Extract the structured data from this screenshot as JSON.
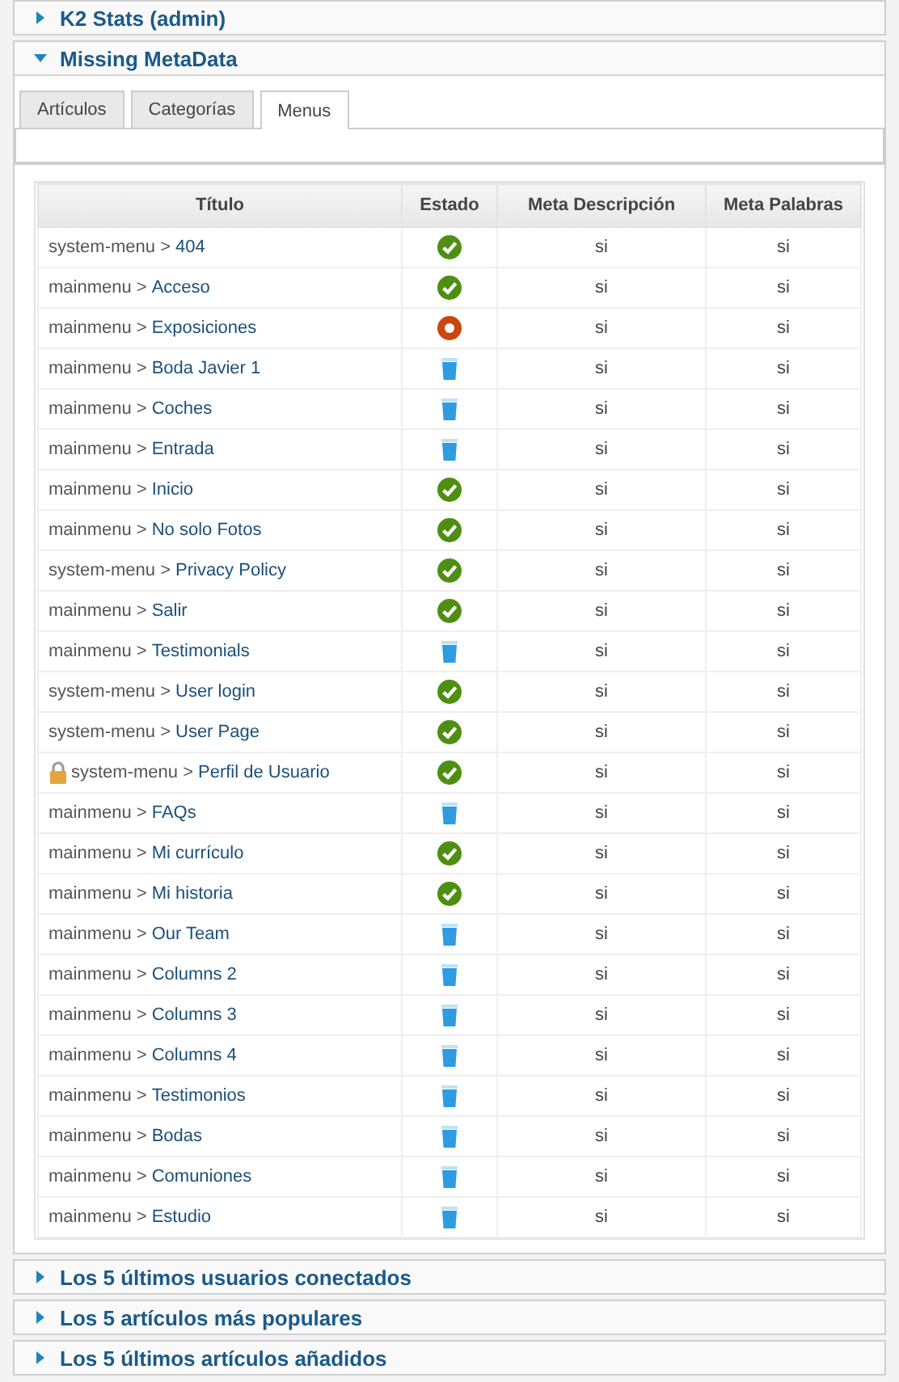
{
  "panels_top": [
    {
      "title": "K2 Stats (admin)",
      "expanded": false
    },
    {
      "title": "Missing MetaData",
      "expanded": true
    }
  ],
  "tabs": [
    {
      "label": "Artículos",
      "selected": false
    },
    {
      "label": "Categorías",
      "selected": false
    },
    {
      "label": "Menus",
      "selected": true
    }
  ],
  "table": {
    "columns": [
      "Título",
      "Estado",
      "Meta Descripción",
      "Meta Palabras"
    ],
    "rows": [
      {
        "menu": "system-menu >",
        "item": "404",
        "locked": false,
        "kind": "published",
        "meta_description": "si",
        "meta_keywords": "si"
      },
      {
        "menu": "mainmenu >",
        "item": "Acceso",
        "locked": false,
        "kind": "published",
        "meta_description": "si",
        "meta_keywords": "si"
      },
      {
        "menu": "mainmenu >",
        "item": "Exposiciones",
        "locked": false,
        "kind": "unpublished",
        "meta_description": "si",
        "meta_keywords": "si"
      },
      {
        "menu": "mainmenu >",
        "item": "Boda Javier 1",
        "locked": false,
        "kind": "trashed",
        "meta_description": "si",
        "meta_keywords": "si"
      },
      {
        "menu": "mainmenu >",
        "item": "Coches",
        "locked": false,
        "kind": "trashed",
        "meta_description": "si",
        "meta_keywords": "si"
      },
      {
        "menu": "mainmenu >",
        "item": "Entrada",
        "locked": false,
        "kind": "trashed",
        "meta_description": "si",
        "meta_keywords": "si"
      },
      {
        "menu": "mainmenu >",
        "item": "Inicio",
        "locked": false,
        "kind": "published",
        "meta_description": "si",
        "meta_keywords": "si"
      },
      {
        "menu": "mainmenu >",
        "item": "No solo Fotos",
        "locked": false,
        "kind": "published",
        "meta_description": "si",
        "meta_keywords": "si"
      },
      {
        "menu": "system-menu >",
        "item": "Privacy Policy",
        "locked": false,
        "kind": "published",
        "meta_description": "si",
        "meta_keywords": "si"
      },
      {
        "menu": "mainmenu >",
        "item": "Salir",
        "locked": false,
        "kind": "published",
        "meta_description": "si",
        "meta_keywords": "si"
      },
      {
        "menu": "mainmenu >",
        "item": "Testimonials",
        "locked": false,
        "kind": "trashed",
        "meta_description": "si",
        "meta_keywords": "si"
      },
      {
        "menu": "system-menu >",
        "item": "User login",
        "locked": false,
        "kind": "published",
        "meta_description": "si",
        "meta_keywords": "si"
      },
      {
        "menu": "system-menu >",
        "item": "User Page",
        "locked": false,
        "kind": "published",
        "meta_description": "si",
        "meta_keywords": "si"
      },
      {
        "menu": "system-menu >",
        "item": "Perfil de Usuario",
        "locked": true,
        "kind": "published",
        "meta_description": "si",
        "meta_keywords": "si"
      },
      {
        "menu": "mainmenu >",
        "item": "FAQs",
        "locked": false,
        "kind": "trashed",
        "meta_description": "si",
        "meta_keywords": "si"
      },
      {
        "menu": "mainmenu >",
        "item": "Mi currículo",
        "locked": false,
        "kind": "published",
        "meta_description": "si",
        "meta_keywords": "si"
      },
      {
        "menu": "mainmenu >",
        "item": "Mi historia",
        "locked": false,
        "kind": "published",
        "meta_description": "si",
        "meta_keywords": "si"
      },
      {
        "menu": "mainmenu >",
        "item": "Our Team",
        "locked": false,
        "kind": "trashed",
        "meta_description": "si",
        "meta_keywords": "si"
      },
      {
        "menu": "mainmenu >",
        "item": "Columns 2",
        "locked": false,
        "kind": "trashed",
        "meta_description": "si",
        "meta_keywords": "si"
      },
      {
        "menu": "mainmenu >",
        "item": "Columns 3",
        "locked": false,
        "kind": "trashed",
        "meta_description": "si",
        "meta_keywords": "si"
      },
      {
        "menu": "mainmenu >",
        "item": "Columns 4",
        "locked": false,
        "kind": "trashed",
        "meta_description": "si",
        "meta_keywords": "si"
      },
      {
        "menu": "mainmenu >",
        "item": "Testimonios",
        "locked": false,
        "kind": "trashed",
        "meta_description": "si",
        "meta_keywords": "si"
      },
      {
        "menu": "mainmenu >",
        "item": "Bodas",
        "locked": false,
        "kind": "trashed",
        "meta_description": "si",
        "meta_keywords": "si"
      },
      {
        "menu": "mainmenu >",
        "item": "Comuniones",
        "locked": false,
        "kind": "trashed",
        "meta_description": "si",
        "meta_keywords": "si"
      },
      {
        "menu": "mainmenu >",
        "item": "Estudio",
        "locked": false,
        "kind": "trashed",
        "meta_description": "si",
        "meta_keywords": "si"
      }
    ]
  },
  "panels_bottom": [
    {
      "title": "Los 5 últimos usuarios conectados",
      "expanded": false
    },
    {
      "title": "Los 5 artículos más populares",
      "expanded": false
    },
    {
      "title": "Los 5 últimos artículos añadidos",
      "expanded": false
    }
  ]
}
